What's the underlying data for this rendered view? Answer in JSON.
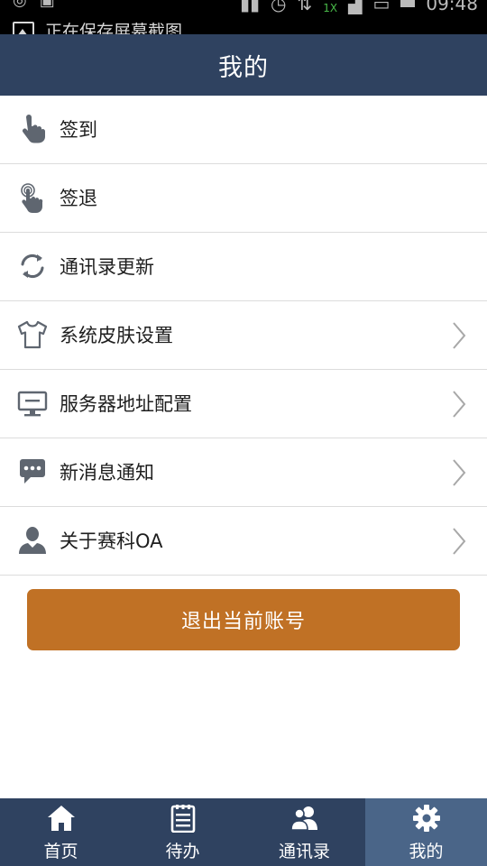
{
  "status_bar": {
    "notification_text": "正在保存屏幕截图",
    "time": "09:48",
    "network": "1X"
  },
  "header": {
    "title": "我的"
  },
  "menu": {
    "items": [
      {
        "label": "签到",
        "icon": "tap-finger-icon",
        "has_chevron": false
      },
      {
        "label": "签退",
        "icon": "touch-finger-icon",
        "has_chevron": false
      },
      {
        "label": "通讯录更新",
        "icon": "refresh-icon",
        "has_chevron": false
      },
      {
        "label": "系统皮肤设置",
        "icon": "shirt-icon",
        "has_chevron": true
      },
      {
        "label": "服务器地址配置",
        "icon": "monitor-icon",
        "has_chevron": true
      },
      {
        "label": "新消息通知",
        "icon": "chat-bubble-icon",
        "has_chevron": true
      },
      {
        "label": "关于赛科OA",
        "icon": "user-icon",
        "has_chevron": true
      }
    ]
  },
  "logout": {
    "label": "退出当前账号"
  },
  "tabs": [
    {
      "label": "首页",
      "icon": "home-icon",
      "active": false
    },
    {
      "label": "待办",
      "icon": "notepad-icon",
      "active": false
    },
    {
      "label": "通讯录",
      "icon": "contacts-icon",
      "active": false
    },
    {
      "label": "我的",
      "icon": "gear-icon",
      "active": true
    }
  ],
  "colors": {
    "header_bg": "#2f4260",
    "active_tab_bg": "#4a6588",
    "logout_bg": "#c07125",
    "icon_gray": "#5f6670"
  }
}
